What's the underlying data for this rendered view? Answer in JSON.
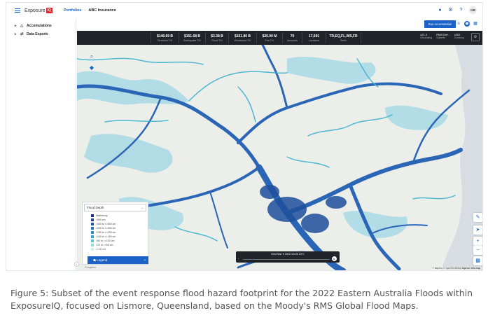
{
  "app": {
    "logo_text": "Exposure",
    "logo_badge": "IQ"
  },
  "breadcrumb": {
    "parent": "Portfolios",
    "separator": "›",
    "current": "ABC Insurance"
  },
  "user": {
    "initials": "GB"
  },
  "sidebar": {
    "items": [
      {
        "label": "Accumulations",
        "icon": "accumulations-icon"
      },
      {
        "label": "Data Exports",
        "icon": "data-exports-icon"
      }
    ]
  },
  "toolbar": {
    "run_button": "Run Accumulation"
  },
  "metrics": [
    {
      "value": "$148.69 B",
      "label": "Terrorism TIV"
    },
    {
      "value": "$151.68 B",
      "label": "Earthquake TIV"
    },
    {
      "value": "$3.38 B",
      "label": "Flood TIV"
    },
    {
      "value": "$151.80 B",
      "label": "Windstorm TIV"
    },
    {
      "value": "$20.00 M",
      "label": "Fire TIV"
    },
    {
      "value": "70",
      "label": "Accounts"
    },
    {
      "value": "17,691",
      "label": "Locations"
    },
    {
      "value": "TR,EQ,FL,WS,FR",
      "label": "Perils"
    }
  ],
  "metrics_right": [
    {
      "value": "v21.0",
      "label": "Geocoding"
    },
    {
      "value": "RMS Def...",
      "label": "Scheme"
    },
    {
      "value": "USD",
      "label": "Currency"
    }
  ],
  "legend": {
    "select_label": "Flood Depth",
    "rows": [
      {
        "label": "Waterbody",
        "color": "#1b2f8a"
      },
      {
        "label": ">500 cm",
        "color": "#1f3f9e"
      },
      {
        "label": ">300 to <=500 cm",
        "color": "#2456b0"
      },
      {
        "label": ">200 to <=300 cm",
        "color": "#2a70c0"
      },
      {
        "label": ">150 to <=200 cm",
        "color": "#2e8bc8"
      },
      {
        "label": ">100 to <=150 cm",
        "color": "#38a5cc"
      },
      {
        "label": ">50 to <=100 cm",
        "color": "#5cc1d0"
      },
      {
        "label": ">10 to <=50 cm",
        "color": "#94dcd8"
      },
      {
        "label": "<=10 cm",
        "color": "#c9efe6"
      }
    ],
    "button_label": "Legend",
    "close": "×"
  },
  "timeline": {
    "label": "Wed Mar 9 2022 00:00 UTC"
  },
  "attribution": {
    "prefix": "© Mapbox © OpenStreetMap",
    "link": "Improve this map"
  },
  "mapbox": "© mapbox",
  "caption": "Figure 5: Subset of the event response flood hazard footprint for the 2022 Eastern Australia Floods within ExposureIQ, focused on Lismore, Queensland, based on the Moody's RMS Global Flood Maps."
}
